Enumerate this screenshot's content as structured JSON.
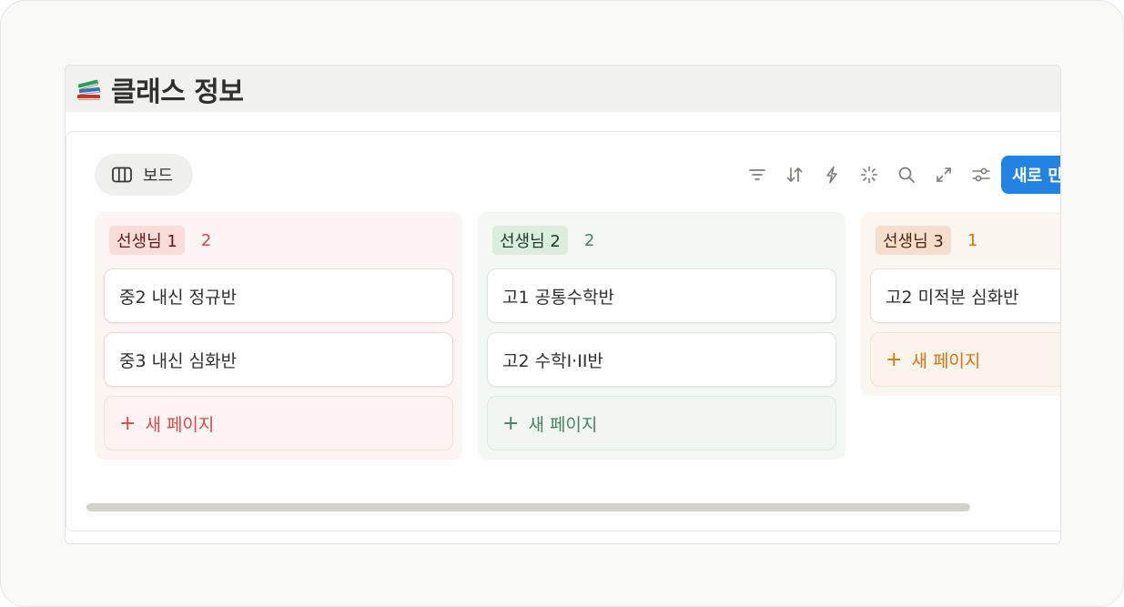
{
  "page": {
    "title": "클래스 정보",
    "icon": "books-icon"
  },
  "view": {
    "tab_label": "보드"
  },
  "toolbar": {
    "new_button_label": "새로 만",
    "icons": [
      "filter-icon",
      "sort-icon",
      "automation-icon",
      "ai-sparkle-icon",
      "search-icon",
      "expand-icon",
      "settings-icon"
    ]
  },
  "colors": {
    "accent": "#2383e2",
    "group1_pill_bg": "#fadcd9",
    "group1_text": "#d44c47",
    "group1_col_bg": "#fdf5f4",
    "group2_pill_bg": "#dbeddb",
    "group2_text": "#448361",
    "group2_col_bg": "#f4f8f5",
    "group3_pill_bg": "#f5dfcc",
    "group3_text": "#d9730d",
    "group3_col_bg": "#fcf6f0"
  },
  "board": {
    "columns": [
      {
        "label": "선생님 1",
        "count": "2",
        "cards": [
          "중2 내신 정규반",
          "중3 내신 심화반"
        ],
        "add_label": "새 페이지"
      },
      {
        "label": "선생님 2",
        "count": "2",
        "cards": [
          "고1 공통수학반",
          "고2 수학I·II반"
        ],
        "add_label": "새 페이지"
      },
      {
        "label": "선생님 3",
        "count": "1",
        "cards": [
          "고2 미적분 심화반"
        ],
        "add_label": "새 페이지"
      }
    ]
  }
}
